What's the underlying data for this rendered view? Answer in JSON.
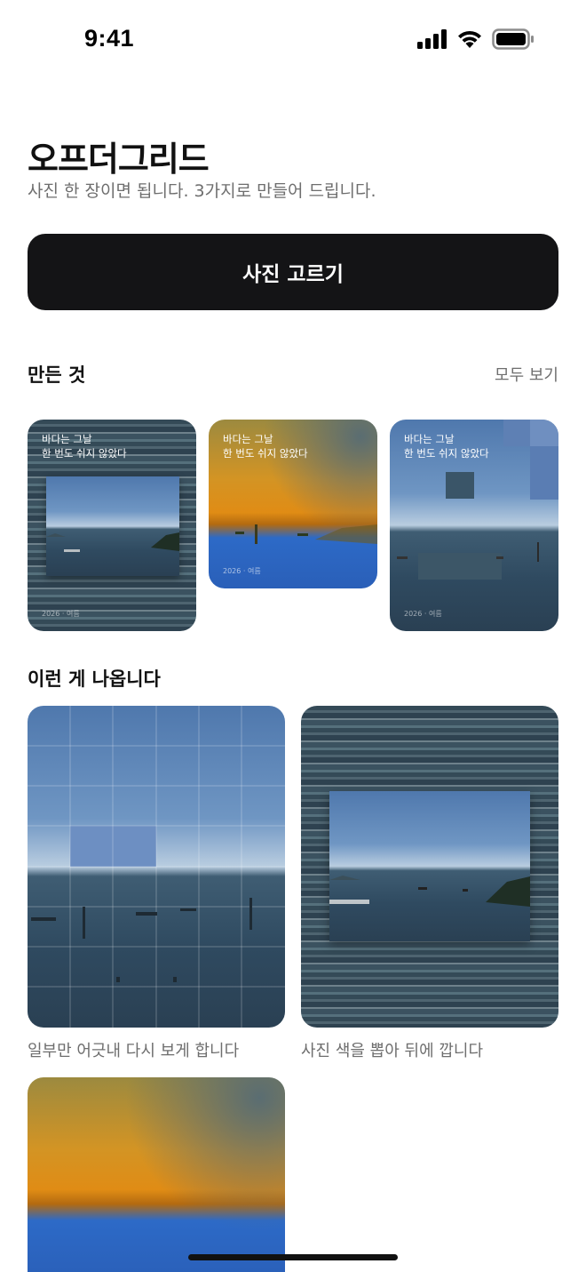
{
  "status_bar": {
    "time": "9:41",
    "icons": [
      "signal-icon",
      "wifi-icon",
      "battery-icon"
    ]
  },
  "header": {
    "title": "오프더그리드",
    "subtitle": "사진 한 장이면 됩니다. 3가지로 만들어 드립니다."
  },
  "primary_button": {
    "label": "사진 고르기"
  },
  "made_section": {
    "title": "만든 것",
    "see_all": "모두 보기",
    "items": [
      {
        "caption_line1": "바다는 그날",
        "caption_line2": "한 번도 쉬지 않았다",
        "date": "2026 · 여름",
        "style": "stripes"
      },
      {
        "caption_line1": "바다는 그날",
        "caption_line2": "한 번도 쉬지 않았다",
        "date": "2026 · 여름",
        "style": "gold"
      },
      {
        "caption_line1": "바다는 그날",
        "caption_line2": "한 번도 쉬지 않았다",
        "date": "2026 · 여름",
        "style": "grid"
      }
    ]
  },
  "examples_section": {
    "title": "이런 게 나옵니다",
    "cards": [
      {
        "label": "일부만 어긋내 다시 보게 합니다",
        "style": "grid"
      },
      {
        "label": "사진 색을 뽑아 뒤에 깝니다",
        "style": "stripes"
      },
      {
        "label": "",
        "style": "gold"
      }
    ]
  },
  "colors": {
    "button_bg": "#141416",
    "text_primary": "#111111",
    "text_secondary": "#6e6e6e"
  }
}
